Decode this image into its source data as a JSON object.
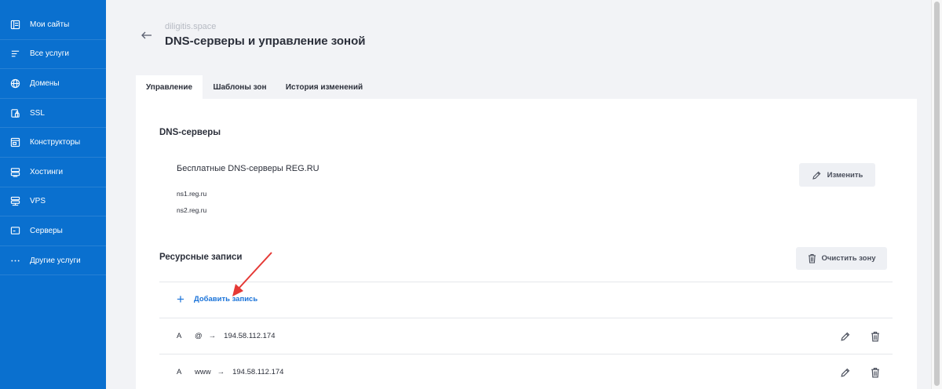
{
  "sidebar": {
    "items": [
      {
        "label": "Мои сайты",
        "icon": "list-icon"
      },
      {
        "label": "Все услуги",
        "icon": "menu-icon"
      },
      {
        "label": "Домены",
        "icon": "globe-icon"
      },
      {
        "label": "SSL",
        "icon": "lock-icon"
      },
      {
        "label": "Конструкторы",
        "icon": "builder-icon"
      },
      {
        "label": "Хостинги",
        "icon": "server-icon"
      },
      {
        "label": "VPS",
        "icon": "vps-icon"
      },
      {
        "label": "Серверы",
        "icon": "monitor-icon"
      },
      {
        "label": "Другие услуги",
        "icon": "dots-icon"
      }
    ]
  },
  "header": {
    "domain": "diligitis.space",
    "title": "DNS-серверы и управление зоной"
  },
  "tabs": [
    {
      "label": "Управление",
      "active": true
    },
    {
      "label": "Шаблоны зон",
      "active": false
    },
    {
      "label": "История изменений",
      "active": false
    }
  ],
  "dns": {
    "heading": "DNS-серверы",
    "provider": "Бесплатные DNS-серверы REG.RU",
    "servers": [
      "ns1.reg.ru",
      "ns2.reg.ru"
    ],
    "edit_label": "Изменить"
  },
  "records": {
    "heading": "Ресурсные записи",
    "clear_label": "Очистить зону",
    "add_label": "Добавить запись",
    "arrow_glyph": "→",
    "items": [
      {
        "type": "A",
        "host": "@",
        "value": "194.58.112.174"
      },
      {
        "type": "A",
        "host": "www",
        "value": "194.58.112.174"
      }
    ]
  },
  "colors": {
    "sidebar": "#0a70cf",
    "accent": "#1a73d9",
    "annotation": "#e53935"
  }
}
